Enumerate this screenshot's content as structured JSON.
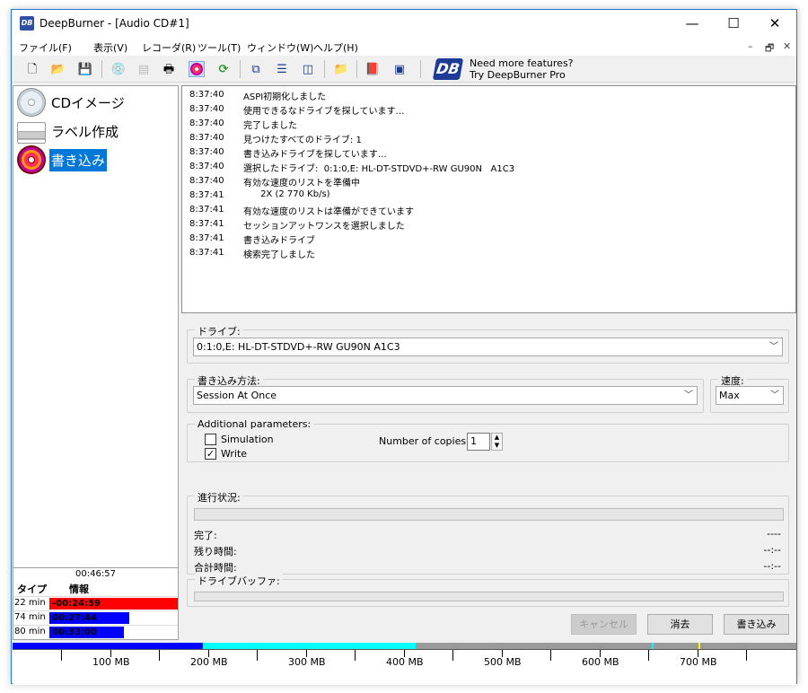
{
  "window": {
    "title": "DeepBurner - [Audio CD#1]",
    "icon": "DB"
  },
  "menu": [
    "ファイル(F)",
    "表示(V)",
    "レコーダ(R)",
    "ツール(T)",
    "ウィンドウ(W)",
    "ヘルプ(H)"
  ],
  "promo": {
    "line1": "Need more features?",
    "line2": "Try DeepBurner Pro",
    "logo": "DB"
  },
  "nav": [
    {
      "label": "CDイメージ"
    },
    {
      "label": "ラベル作成"
    },
    {
      "label": "書き込み"
    }
  ],
  "stats": {
    "elapsed": "00:46:57",
    "col_type": "タイプ",
    "col_info": "情報",
    "rows": [
      {
        "type": "22 min",
        "info": "-00:24:59",
        "color": "#ff0000"
      },
      {
        "type": "74 min",
        "info": "00:27:44",
        "color": "#0000ff"
      },
      {
        "type": "80 min",
        "info": "00:33:00",
        "color": "#0000ff"
      }
    ]
  },
  "log": [
    {
      "time": "8:37:40",
      "msg": "ASPI初期化しました"
    },
    {
      "time": "8:37:40",
      "msg": "使用できるなドライブを探しています…"
    },
    {
      "time": "8:37:40",
      "msg": "完了しました"
    },
    {
      "time": "8:37:40",
      "msg": "見つけたすべてのドライブ: 1"
    },
    {
      "time": "8:37:40",
      "msg": "書き込みドライブを探しています…"
    },
    {
      "time": "8:37:40",
      "msg": "選択したドライブ:  0:1:0,E: HL-DT-STDVD+-RW GU90N   A1C3"
    },
    {
      "time": "8:37:40",
      "msg": "有効な速度のリストを準備中"
    },
    {
      "time": "8:37:41",
      "msg": "      2X (2 770 Kb/s)"
    },
    {
      "time": "8:37:41",
      "msg": "有効な速度のリストは準備ができています"
    },
    {
      "time": "8:37:41",
      "msg": "セッションアットワンスを選択しました"
    },
    {
      "time": "8:37:41",
      "msg": "書き込みドライブ"
    },
    {
      "time": "8:37:41",
      "msg": "検索完了しました"
    }
  ],
  "drive": {
    "label": "ドライブ:",
    "value": "0:1:0,E: HL-DT-STDVD+-RW GU90N   A1C3"
  },
  "method": {
    "label": "書き込み方法:",
    "value": "Session At Once"
  },
  "speed": {
    "label": "速度:",
    "value": "Max"
  },
  "params": {
    "label": "Additional parameters:",
    "simulation": "Simulation",
    "simulation_checked": false,
    "write": "Write",
    "write_checked": true,
    "copies_label": "Number of copies:",
    "copies": "1"
  },
  "progress": {
    "label": "進行状況:",
    "fraction": 0,
    "done_label": "完了:",
    "done_value": "----",
    "remaining_label": "残り時間:",
    "remaining_value": "--:--",
    "total_label": "合計時間:",
    "total_value": "--:--"
  },
  "buffer": {
    "label": "ドライブバッファ:",
    "fraction": 0
  },
  "buttons": {
    "cancel": "キャンセル",
    "erase": "消去",
    "burn": "書き込み"
  },
  "ruler": {
    "labels": [
      "100 MB",
      "200 MB",
      "300 MB",
      "400 MB",
      "500 MB",
      "600 MB",
      "700 MB"
    ]
  },
  "colors": {
    "accent": "#0078d7",
    "cap_used": "#0000ff",
    "cap_over": "#00ffff",
    "log_border": "#8e8e8e"
  }
}
